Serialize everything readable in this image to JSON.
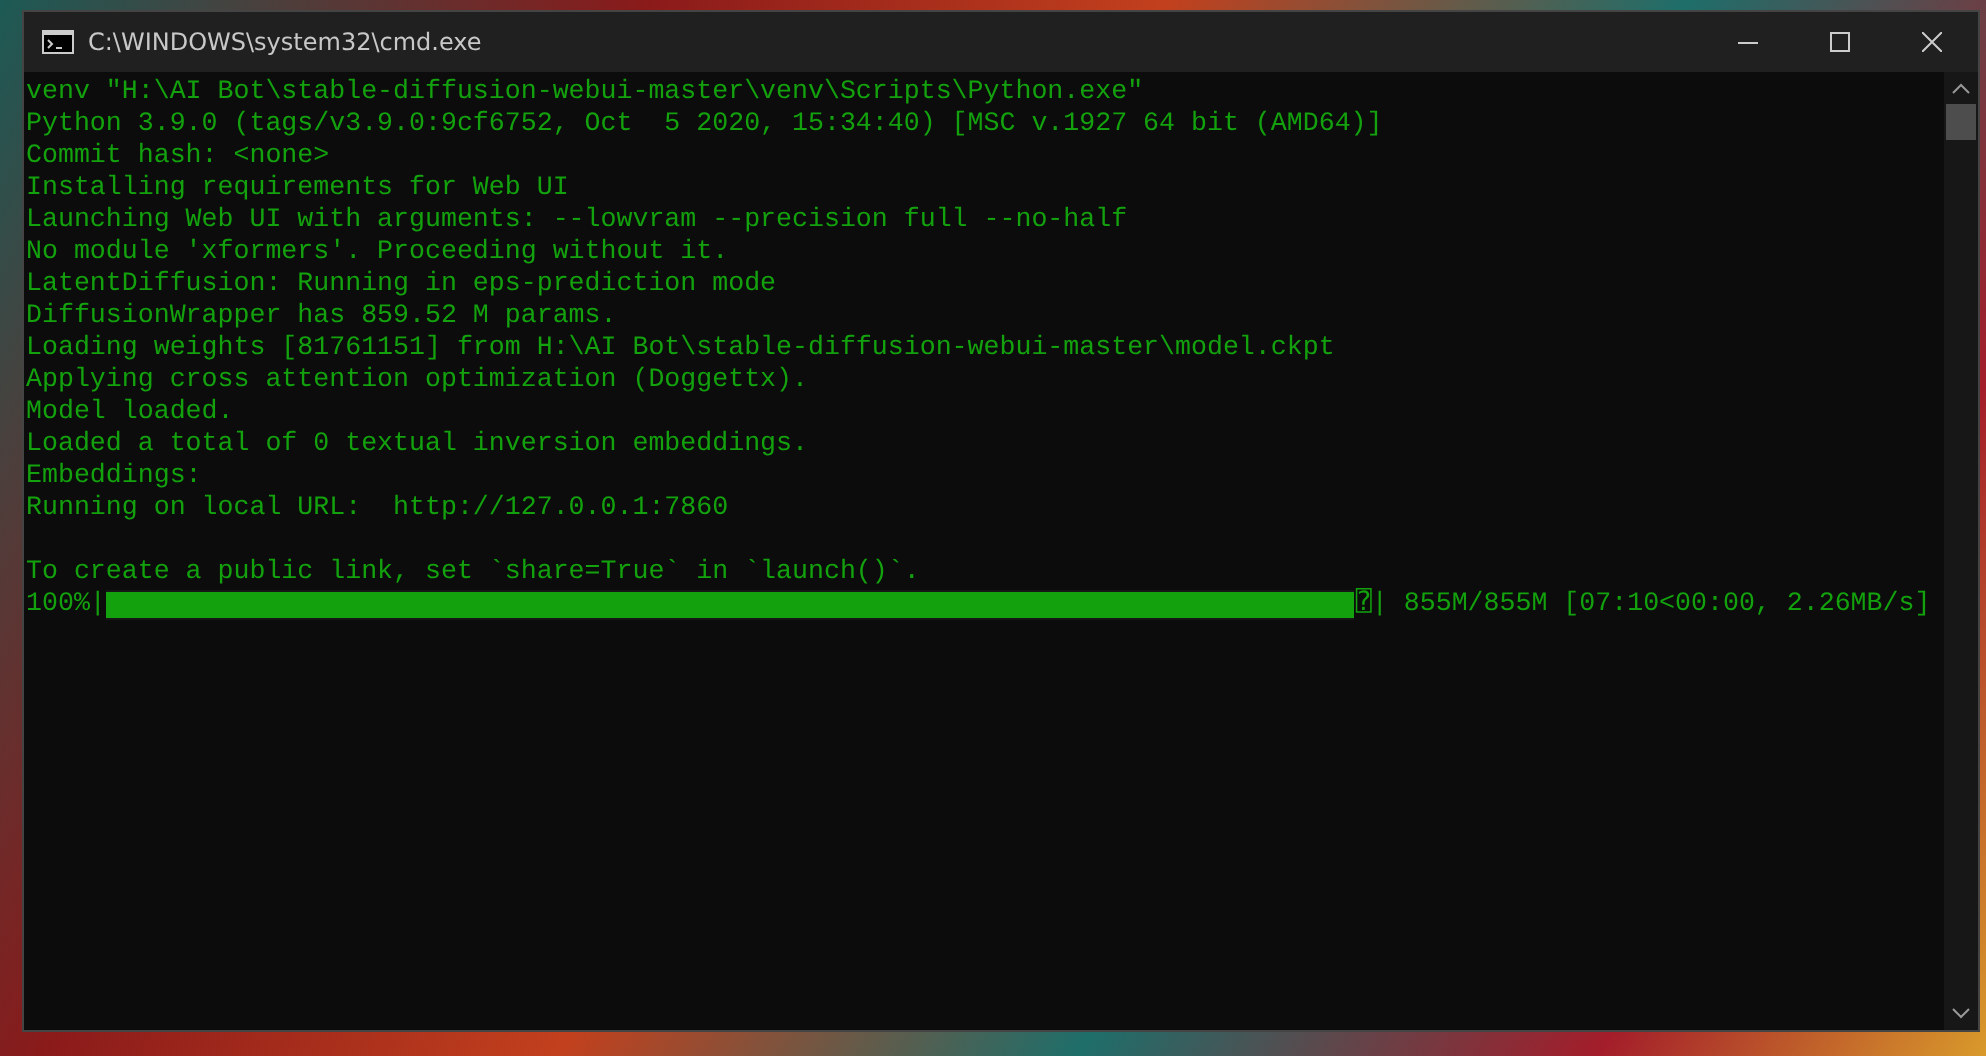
{
  "window": {
    "title": "C:\\WINDOWS\\system32\\cmd.exe"
  },
  "console": {
    "blocks": [
      [
        "venv \"H:\\AI Bot\\stable-diffusion-webui-master\\venv\\Scripts\\Python.exe\"",
        "Python 3.9.0 (tags/v3.9.0:9cf6752, Oct  5 2020, 15:34:40) [MSC v.1927 64 bit (AMD64)]",
        "Commit hash: <none>",
        "Installing requirements for Web UI",
        "Launching Web UI with arguments: --lowvram --precision full --no-half",
        "No module 'xformers'. Proceeding without it.",
        "LatentDiffusion: Running in eps-prediction mode",
        "DiffusionWrapper has 859.52 M params.",
        "Loading weights [81761151] from H:\\AI Bot\\stable-diffusion-webui-master\\model.ckpt",
        "Applying cross attention optimization (Doggettx).",
        "Model loaded.",
        "Loaded a total of 0 textual inversion embeddings.",
        "Embeddings:",
        "Running on local URL:  http://127.0.0.1:7860"
      ],
      [
        "To create a public link, set `share=True` in `launch()`."
      ]
    ],
    "progress": {
      "percent": "100%|",
      "level": 1,
      "end_glyph": "⍰",
      "stats": "| 855M/855M [07:10<00:00, 2.26MB/s]"
    }
  }
}
